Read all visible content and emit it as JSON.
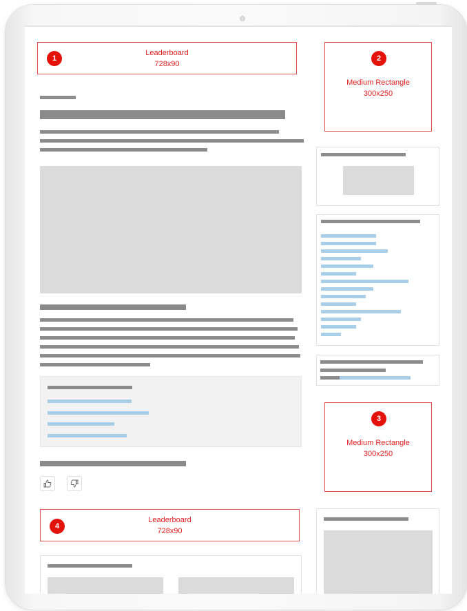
{
  "ads": [
    {
      "num": "1",
      "name": "Leaderboard",
      "size": "728x90"
    },
    {
      "num": "2",
      "name": "Medium Rectangle",
      "size": "300x250"
    },
    {
      "num": "3",
      "name": "Medium Rectangle",
      "size": "300x250"
    },
    {
      "num": "4",
      "name": "Leaderboard",
      "size": "728x90"
    }
  ],
  "icons": {
    "thumbs_up": "thumbs-up-icon",
    "thumbs_down": "thumbs-down-icon"
  },
  "colors": {
    "ad_accent": "#e3120b",
    "placeholder_text": "#8c8c8c",
    "placeholder_link": "#a9cfe8",
    "placeholder_image": "#dbdbdb"
  }
}
